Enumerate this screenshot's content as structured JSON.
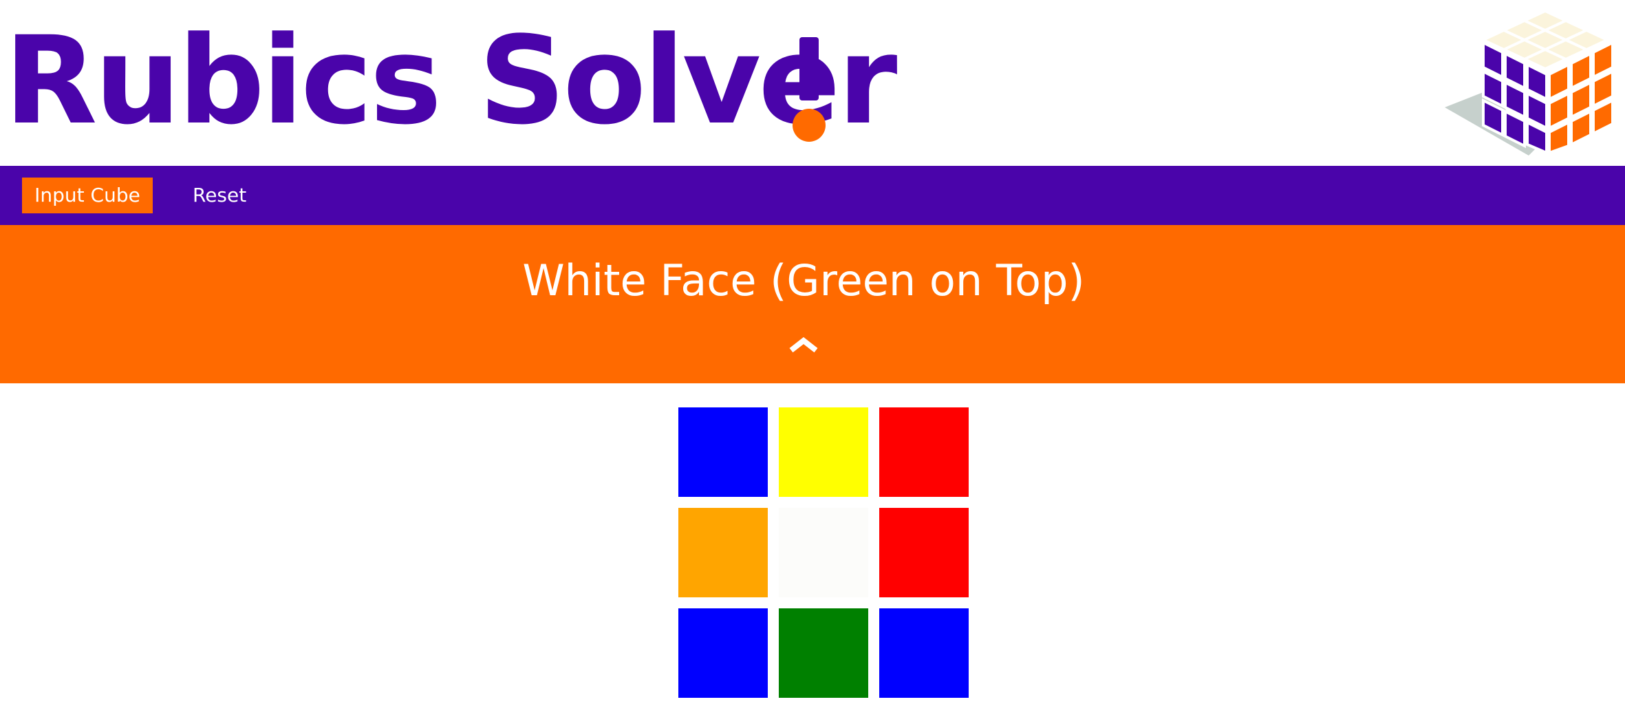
{
  "header": {
    "title": "Rubics Solver",
    "title_accent_color": "#ff6a00",
    "brand_color": "#4a04aa",
    "logo_icon": "rubiks-cube-icon"
  },
  "nav": {
    "items": [
      {
        "label": "Input Cube",
        "active": true
      },
      {
        "label": "Reset",
        "active": false
      }
    ]
  },
  "face": {
    "title": "White Face (Green on Top)",
    "banner_color": "#ff6a00",
    "collapse_icon": "chevron-up-icon",
    "cells": [
      {
        "color": "blue",
        "hex": "#0000ff"
      },
      {
        "color": "yellow",
        "hex": "#ffff00"
      },
      {
        "color": "red",
        "hex": "#ff0000"
      },
      {
        "color": "orange",
        "hex": "#ffa500"
      },
      {
        "color": "white",
        "hex": "#fcfcfa"
      },
      {
        "color": "red",
        "hex": "#ff0000"
      },
      {
        "color": "blue",
        "hex": "#0000ff"
      },
      {
        "color": "green",
        "hex": "#008000"
      },
      {
        "color": "blue",
        "hex": "#0000ff"
      }
    ]
  }
}
